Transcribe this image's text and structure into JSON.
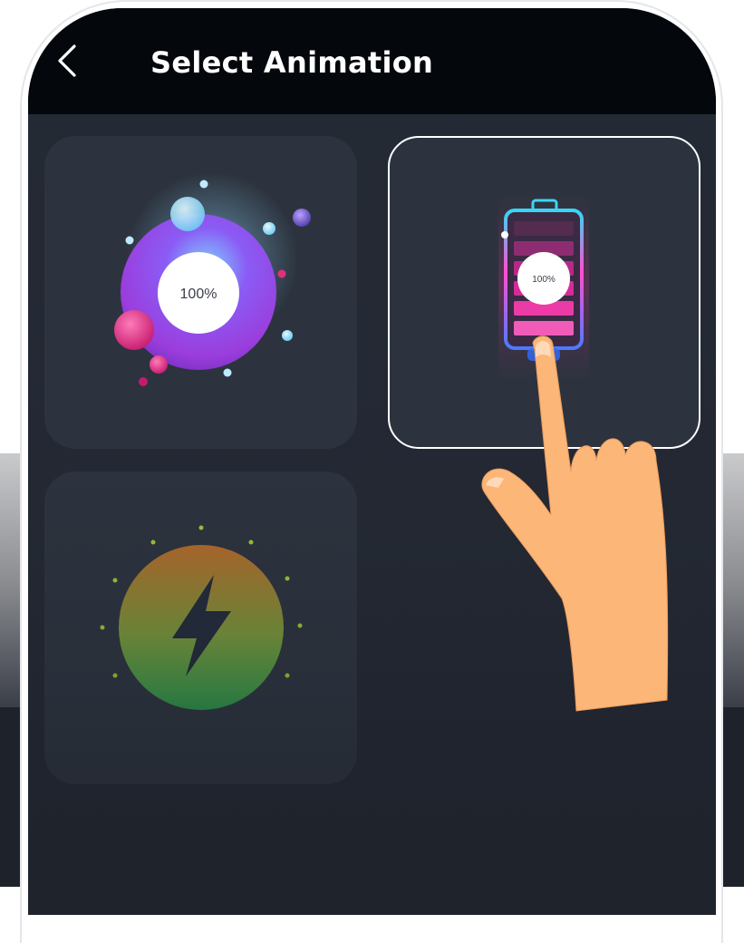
{
  "header": {
    "title": "Select Animation",
    "back_icon": "chevron-left-icon"
  },
  "animations": [
    {
      "id": "bubble",
      "percent_label": "100%",
      "selected": false
    },
    {
      "id": "battery",
      "percent_label": "100%",
      "selected": true
    },
    {
      "id": "lightning",
      "icon": "lightning-bolt-icon",
      "selected": false
    }
  ],
  "colors": {
    "header_bg": "#04070c",
    "screen_bg": "#232833",
    "card_bg": "#2c333e",
    "selected_border": "#ffffff",
    "accent_pink": "#ff2aa5",
    "accent_cyan": "#39d6f5",
    "hand_skin": "#fbb678"
  }
}
